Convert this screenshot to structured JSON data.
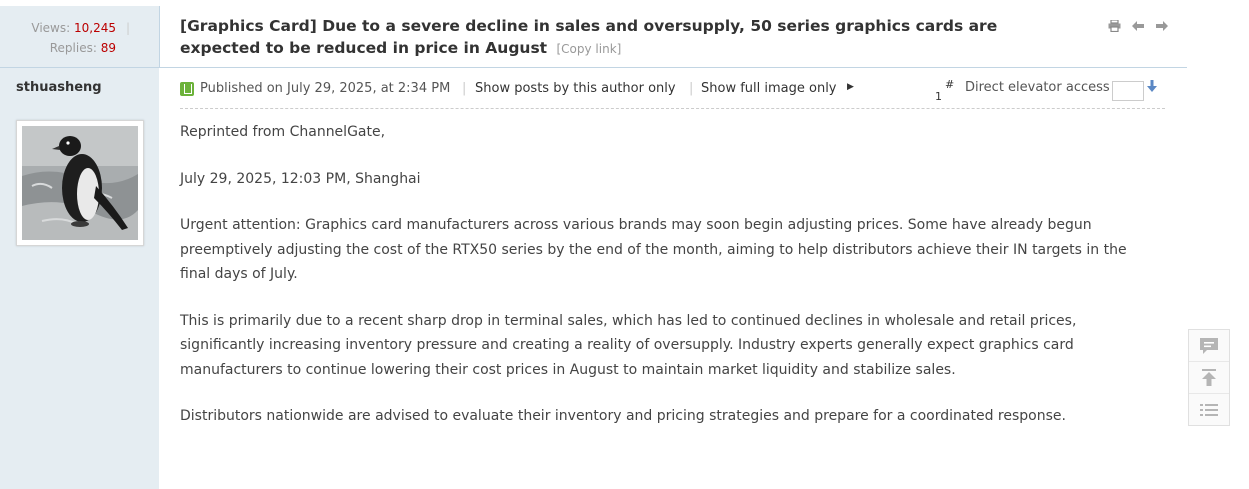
{
  "header": {
    "views_label": "Views:",
    "views_count": "10,245",
    "replies_label": "Replies:",
    "replies_count": "89",
    "separator": "|",
    "title": "[Graphics Card] Due to a severe decline in sales and oversupply, 50 series graphics cards are expected to be reduced in price in August",
    "copy_link": "[Copy link]",
    "icons": [
      "print-icon",
      "previous-thread-icon",
      "next-thread-icon"
    ]
  },
  "author": {
    "name": "sthuasheng",
    "avatar": "penguin-avatar"
  },
  "post": {
    "published": "Published on July 29, 2025, at 2:34 PM",
    "show_author_posts": "Show posts by this author only",
    "show_full_image": "Show full image only",
    "floor_number": "1",
    "floor_mark": "#",
    "elevator_label": "Direct elevator access",
    "elevator_value": "",
    "paragraphs": [
      "Reprinted from ChannelGate,",
      "July 29, 2025, 12:03 PM, Shanghai",
      "Urgent attention: Graphics card manufacturers across various brands may soon begin adjusting prices. Some have already begun preemptively adjusting the cost of the RTX50 series by the end of the month, aiming to help distributors achieve their IN targets in the final days of July.",
      "This is primarily due to a recent sharp drop in terminal sales, which has led to continued declines in wholesale and retail prices, significantly increasing inventory pressure and creating a reality of oversupply. Industry experts generally expect graphics card manufacturers to continue lowering their cost prices in August to maintain market liquidity and stabilize sales.",
      "Distributors nationwide are advised to evaluate their inventory and pricing strategies and prepare for a coordinated response."
    ]
  },
  "floatbar": [
    "reply-icon",
    "back-to-top-icon",
    "list-icon"
  ],
  "colors": {
    "sidebar_bg": "#e5edf2",
    "count_red": "#bb0000",
    "online_green": "#6cb23a"
  }
}
